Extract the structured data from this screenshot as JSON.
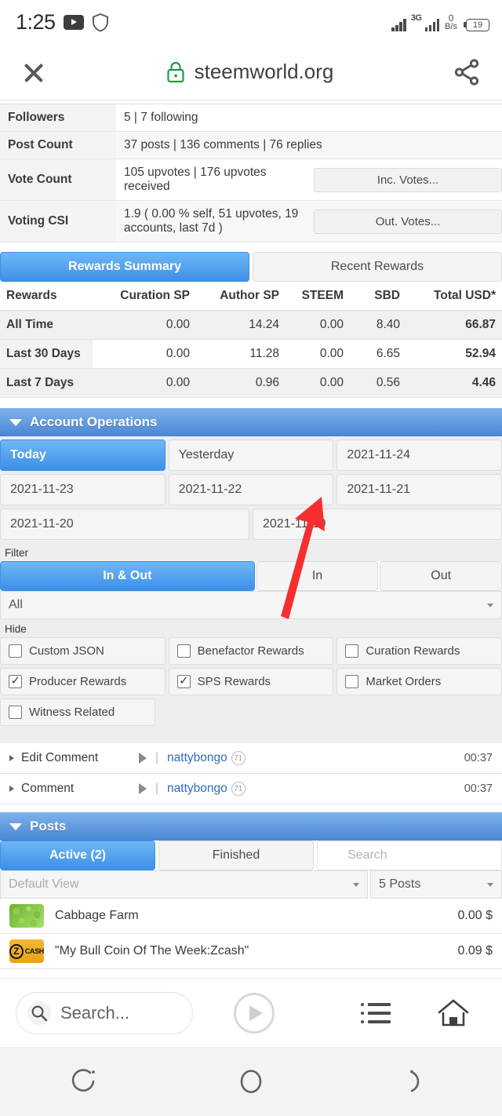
{
  "statusbar": {
    "clock": "1:25",
    "youtube_icon": "youtube-badge-icon",
    "shield_icon": "shield-icon",
    "network_type": "3G",
    "data_rate_value": "0",
    "data_rate_unit": "B/s",
    "battery_percent": "19"
  },
  "browser": {
    "close_icon": "close-icon",
    "lock_icon": "lock-secure-icon",
    "url": "steemworld.org",
    "share_icon": "share-icon"
  },
  "account_stats": {
    "rows": [
      {
        "label": "Followers",
        "value": "5  |  7 following",
        "button": ""
      },
      {
        "label": "Post Count",
        "value": "37 posts  |  136 comments  |  76 replies",
        "button": ""
      },
      {
        "label": "Vote Count",
        "value": "105 upvotes  |  176 upvotes received",
        "button": "Inc. Votes..."
      },
      {
        "label": "Voting CSI",
        "value": "1.9 ( 0.00 % self, 51 upvotes, 19 accounts, last 7d )",
        "button": "Out. Votes..."
      }
    ]
  },
  "rewards": {
    "tabs": [
      {
        "label": "Rewards Summary",
        "active": true
      },
      {
        "label": "Recent Rewards",
        "active": false
      }
    ],
    "headers": [
      "Rewards",
      "Curation SP",
      "Author SP",
      "STEEM",
      "SBD",
      "Total USD*"
    ],
    "rows": [
      {
        "period": "All Time",
        "curation_sp": "0.00",
        "author_sp": "14.24",
        "steem": "0.00",
        "sbd": "8.40",
        "total_usd": "66.87"
      },
      {
        "period": "Last 30 Days",
        "curation_sp": "0.00",
        "author_sp": "11.28",
        "steem": "0.00",
        "sbd": "6.65",
        "total_usd": "52.94"
      },
      {
        "period": "Last 7 Days",
        "curation_sp": "0.00",
        "author_sp": "0.96",
        "steem": "0.00",
        "sbd": "0.56",
        "total_usd": "4.46"
      }
    ]
  },
  "account_operations": {
    "title": "Account Operations",
    "dates": [
      {
        "label": "Today",
        "active": true
      },
      {
        "label": "Yesterday",
        "active": false
      },
      {
        "label": "2021-11-24",
        "active": false
      },
      {
        "label": "2021-11-23",
        "active": false
      },
      {
        "label": "2021-11-22",
        "active": false
      },
      {
        "label": "2021-11-21",
        "active": false
      },
      {
        "label": "2021-11-20",
        "active": false
      },
      {
        "label": "2021-11-19",
        "active": false
      }
    ],
    "filter_label": "Filter",
    "filter_tabs": [
      {
        "label": "In & Out",
        "active": true
      },
      {
        "label": "In",
        "active": false
      },
      {
        "label": "Out",
        "active": false
      }
    ],
    "filter_select_value": "All",
    "hide_label": "Hide",
    "hide_options": [
      {
        "label": "Custom JSON",
        "checked": false
      },
      {
        "label": "Benefactor Rewards",
        "checked": false
      },
      {
        "label": "Curation Rewards",
        "checked": false
      },
      {
        "label": "Producer Rewards",
        "checked": true
      },
      {
        "label": "SPS Rewards",
        "checked": true
      },
      {
        "label": "Market Orders",
        "checked": false
      },
      {
        "label": "Witness Related",
        "checked": false
      }
    ],
    "operations": [
      {
        "type": "Edit Comment",
        "account": "nattybongo",
        "reputation": "71",
        "time": "00:37"
      },
      {
        "type": "Comment",
        "account": "nattybongo",
        "reputation": "71",
        "time": "00:37"
      }
    ]
  },
  "posts": {
    "title": "Posts",
    "tabs": [
      {
        "label": "Active (2)",
        "active": true
      },
      {
        "label": "Finished",
        "active": false
      }
    ],
    "search_placeholder": "Search",
    "view_select": "Default View",
    "count_select": "5 Posts",
    "items": [
      {
        "title": "Cabbage Farm",
        "value": "0.00 $",
        "thumb": "cabbage-thumbnail"
      },
      {
        "title": "\"My Bull Coin Of The Week:Zcash\"",
        "value": "0.09 $",
        "thumb": "zcash-thumbnail"
      }
    ]
  },
  "bottom_bar": {
    "search_icon": "search-icon",
    "search_text": "Search...",
    "play_icon": "play-circle-icon",
    "list_icon": "list-icon",
    "home_icon": "home-icon"
  },
  "navbar": {
    "recent_icon": "recent-apps-icon",
    "home_icon": "home-circle-icon",
    "back_icon": "back-icon"
  },
  "annotation": {
    "arrow_color": "#f52f2f",
    "arrow_icon": "red-arrow-pointer"
  }
}
